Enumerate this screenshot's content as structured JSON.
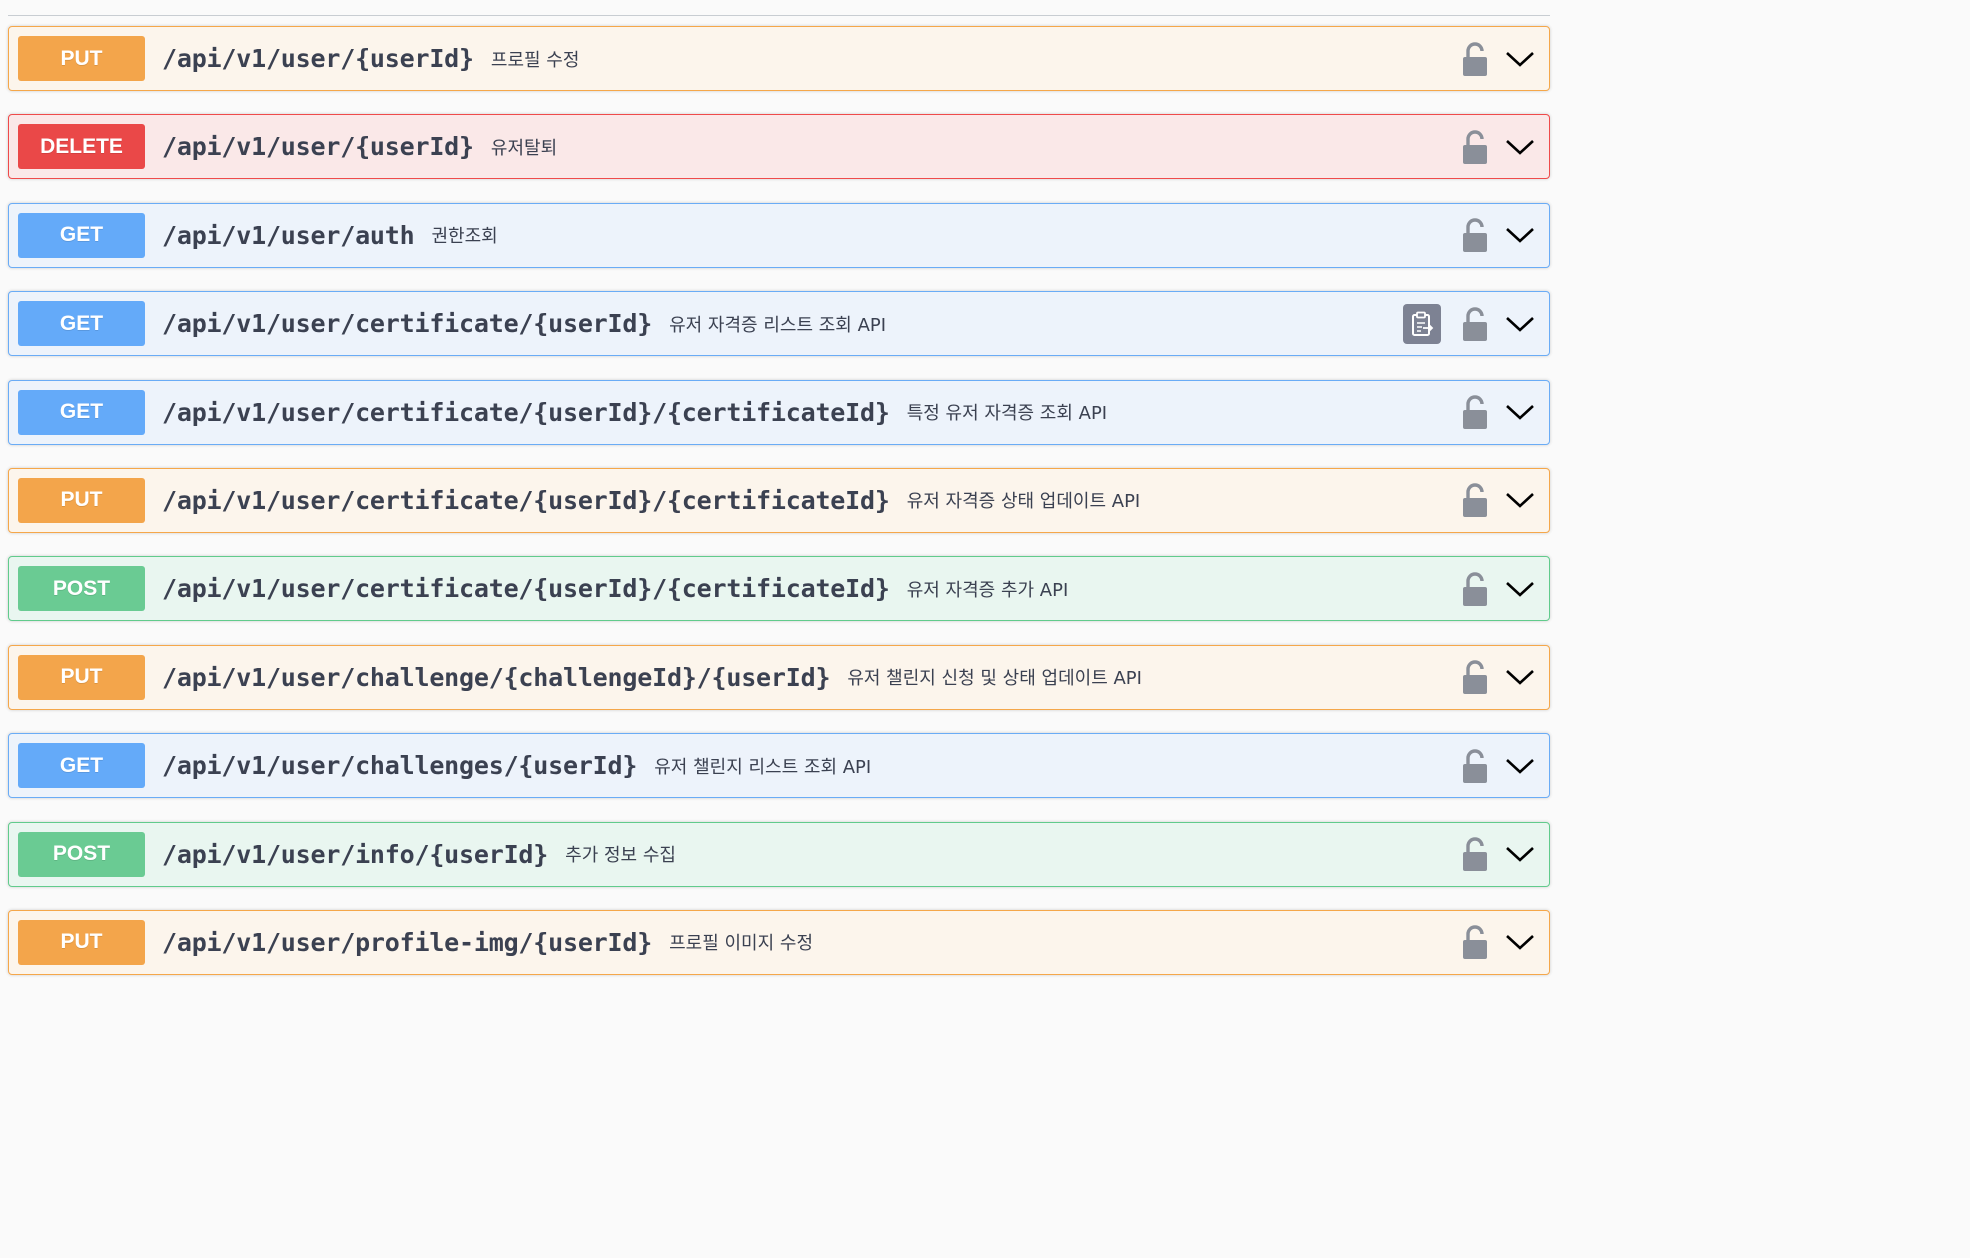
{
  "colors": {
    "PUT": "#f3a54b",
    "DELETE": "#ea4848",
    "GET": "#64aaf9",
    "POST": "#6acb93",
    "text": "#3b4151",
    "icon": "#8a8f99"
  },
  "operations": [
    {
      "method": "PUT",
      "path": "/api/v1/user/{userId}",
      "summary": "프로필 수정",
      "icon": "unlocked-lock-icon"
    },
    {
      "method": "DELETE",
      "path": "/api/v1/user/{userId}",
      "summary": "유저탈퇴",
      "icon": "unlocked-lock-icon"
    },
    {
      "method": "GET",
      "path": "/api/v1/user/auth",
      "summary": "권한조회",
      "icon": "unlocked-lock-icon"
    },
    {
      "method": "GET",
      "path": "/api/v1/user/certificate/{userId}",
      "summary": "유저 자격증 리스트 조회 API",
      "icon": "unlocked-lock-icon",
      "copy_icon": "copy-to-clipboard-icon"
    },
    {
      "method": "GET",
      "path": "/api/v1/user/certificate/{userId}/{certificateId}",
      "summary": "특정 유저 자격증 조회 API",
      "icon": "unlocked-lock-icon"
    },
    {
      "method": "PUT",
      "path": "/api/v1/user/certificate/{userId}/{certificateId}",
      "summary": "유저 자격증 상태 업데이트 API",
      "icon": "unlocked-lock-icon"
    },
    {
      "method": "POST",
      "path": "/api/v1/user/certificate/{userId}/{certificateId}",
      "summary": "유저 자격증 추가 API",
      "icon": "unlocked-lock-icon"
    },
    {
      "method": "PUT",
      "path": "/api/v1/user/challenge/{challengeId}/{userId}",
      "summary": "유저 챌린지 신청 및 상태 업데이트 API",
      "icon": "unlocked-lock-icon"
    },
    {
      "method": "GET",
      "path": "/api/v1/user/challenges/{userId}",
      "summary": "유저 챌린지 리스트 조회 API",
      "icon": "unlocked-lock-icon"
    },
    {
      "method": "POST",
      "path": "/api/v1/user/info/{userId}",
      "summary": "추가 정보 수집",
      "icon": "unlocked-lock-icon"
    },
    {
      "method": "PUT",
      "path": "/api/v1/user/profile-img/{userId}",
      "summary": "프로필 이미지 수정",
      "icon": "unlocked-lock-icon"
    }
  ]
}
